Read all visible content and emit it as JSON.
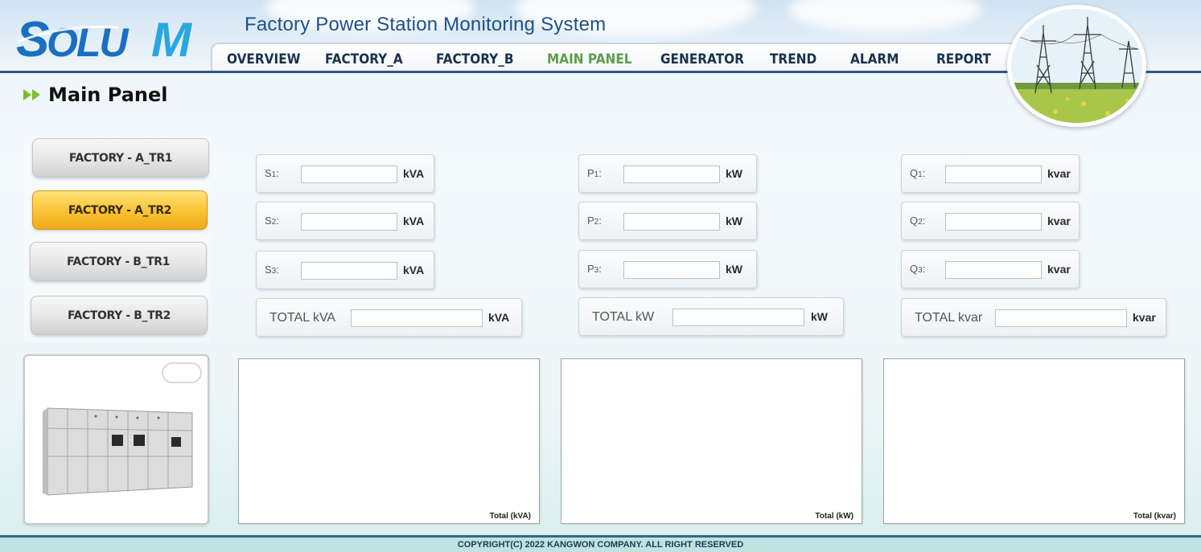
{
  "header": {
    "logo_text": "SOLU M",
    "app_title": "Factory Power Station Monitoring System",
    "nav": [
      {
        "label": "OVERVIEW",
        "active": false
      },
      {
        "label": "FACTORY_A",
        "active": false
      },
      {
        "label": "FACTORY_B",
        "active": false
      },
      {
        "label": "MAIN PANEL",
        "active": true
      },
      {
        "label": "GENERATOR",
        "active": false
      },
      {
        "label": "TREND",
        "active": false
      },
      {
        "label": "ALARM",
        "active": false
      },
      {
        "label": "REPORT",
        "active": false
      }
    ]
  },
  "page": {
    "title": "Main Panel"
  },
  "sidebar": {
    "buttons": [
      {
        "label": "FACTORY - A_TR1",
        "active": false
      },
      {
        "label": "FACTORY - A_TR2",
        "active": true
      },
      {
        "label": "FACTORY - B_TR1",
        "active": false
      },
      {
        "label": "FACTORY - B_TR2",
        "active": false
      }
    ]
  },
  "groups": {
    "apparent": {
      "rows": [
        {
          "label": "S",
          "sub": "1",
          "suffix": ":",
          "value": "",
          "unit": "kVA"
        },
        {
          "label": "S",
          "sub": "2",
          "suffix": ":",
          "value": "",
          "unit": "kVA"
        },
        {
          "label": "S",
          "sub": "3",
          "suffix": ":",
          "value": "",
          "unit": "kVA"
        }
      ],
      "total": {
        "label": "TOTAL kVA",
        "value": "",
        "unit": "kVA"
      },
      "chart_caption": "Total (kVA)"
    },
    "active": {
      "rows": [
        {
          "label": "P",
          "sub": "1",
          "suffix": ":",
          "value": "",
          "unit": "kW"
        },
        {
          "label": "P",
          "sub": "2",
          "suffix": ":",
          "value": "",
          "unit": "kW"
        },
        {
          "label": "P",
          "sub": "3",
          "suffix": ":",
          "value": "",
          "unit": "kW"
        }
      ],
      "total": {
        "label": "TOTAL kW",
        "value": "",
        "unit": "kW"
      },
      "chart_caption": "Total (kW)"
    },
    "reactive": {
      "rows": [
        {
          "label": "Q",
          "sub": "1",
          "suffix": ":",
          "value": "",
          "unit": "kvar"
        },
        {
          "label": "Q",
          "sub": "2",
          "suffix": ":",
          "value": "",
          "unit": "kvar"
        },
        {
          "label": "Q",
          "sub": "3",
          "suffix": ":",
          "value": "",
          "unit": "kvar"
        }
      ],
      "total": {
        "label": "TOTAL kvar",
        "value": "",
        "unit": "kvar"
      },
      "chart_caption": "Total (kvar)"
    }
  },
  "footer": {
    "copyright": "COPYRIGHT(C) 2022 KANGWON COMPANY. ALL RIGHT RESERVED"
  },
  "colors": {
    "brand_blue": "#1a6fc0",
    "nav_active": "#5b9e4a",
    "active_button": "#f8c233",
    "header_line": "#2f5a7e"
  }
}
